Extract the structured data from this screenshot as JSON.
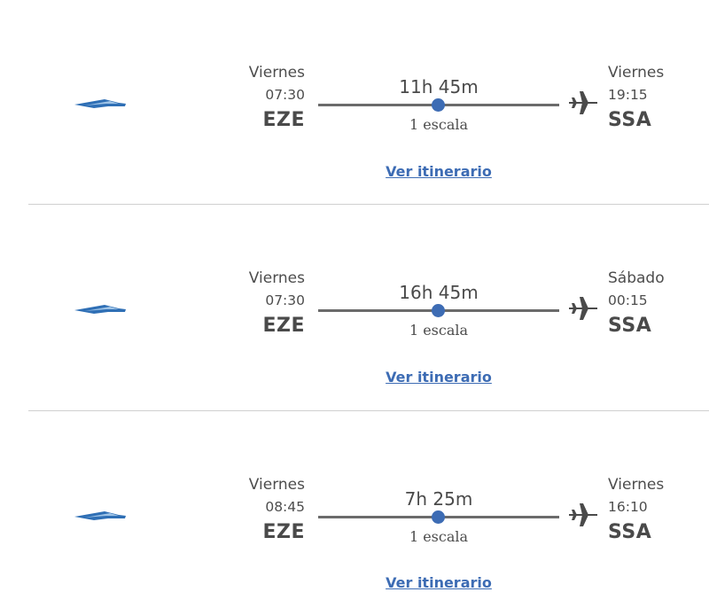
{
  "flights": [
    {
      "airline_icon": "aerolineas-argentinas-logo-icon",
      "departure": {
        "day": "Viernes",
        "time": "07:30",
        "airport": "EZE"
      },
      "duration": "11h 45m",
      "stops": "1 escala",
      "arrival": {
        "day": "Viernes",
        "time": "19:15",
        "airport": "SSA"
      },
      "itinerary_link": "Ver itinerario"
    },
    {
      "airline_icon": "aerolineas-argentinas-logo-icon",
      "departure": {
        "day": "Viernes",
        "time": "07:30",
        "airport": "EZE"
      },
      "duration": "16h 45m",
      "stops": "1 escala",
      "arrival": {
        "day": "Sábado",
        "time": "00:15",
        "airport": "SSA"
      },
      "itinerary_link": "Ver itinerario"
    },
    {
      "airline_icon": "aerolineas-argentinas-logo-icon",
      "departure": {
        "day": "Viernes",
        "time": "08:45",
        "airport": "EZE"
      },
      "duration": "7h 25m",
      "stops": "1 escala",
      "arrival": {
        "day": "Viernes",
        "time": "16:10",
        "airport": "SSA"
      },
      "itinerary_link": "Ver itinerario"
    }
  ],
  "icons": {
    "airline": "aerolineas-argentinas-logo-icon",
    "arrival": "airplane-icon",
    "progress": "route-dot"
  },
  "colors": {
    "accent": "#3d6cb4",
    "text": "#4a4a4a",
    "line": "#6b6b6b",
    "divider": "#d0d0d0"
  }
}
